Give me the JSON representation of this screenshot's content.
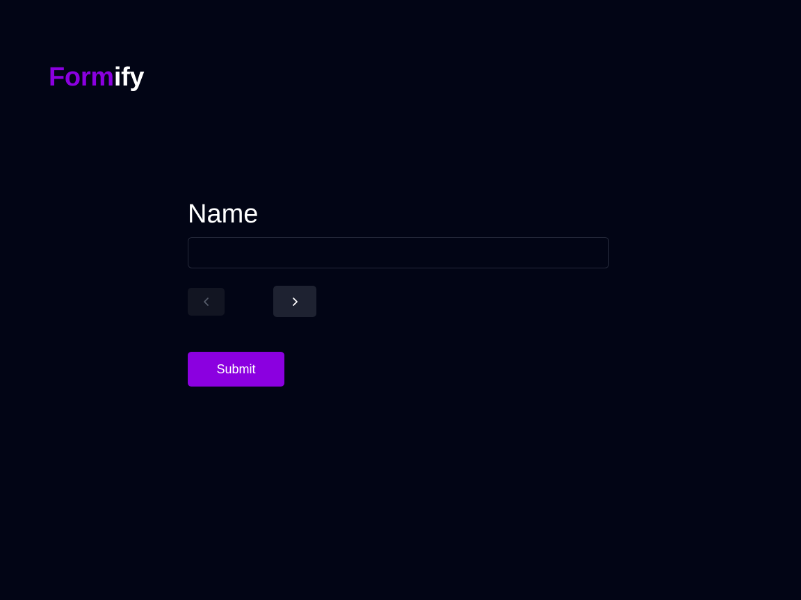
{
  "brand": {
    "name_accent": "Form",
    "name_rest": "ify",
    "accent_color": "#8b00e0"
  },
  "form": {
    "field_label": "Name",
    "field_value": "",
    "field_placeholder": ""
  },
  "navigation": {
    "prev_icon": "chevron-left-icon",
    "prev_disabled": true,
    "next_icon": "chevron-right-icon",
    "next_disabled": false
  },
  "actions": {
    "submit_label": "Submit"
  },
  "colors": {
    "background": "#020515",
    "primary": "#8b00e0"
  }
}
